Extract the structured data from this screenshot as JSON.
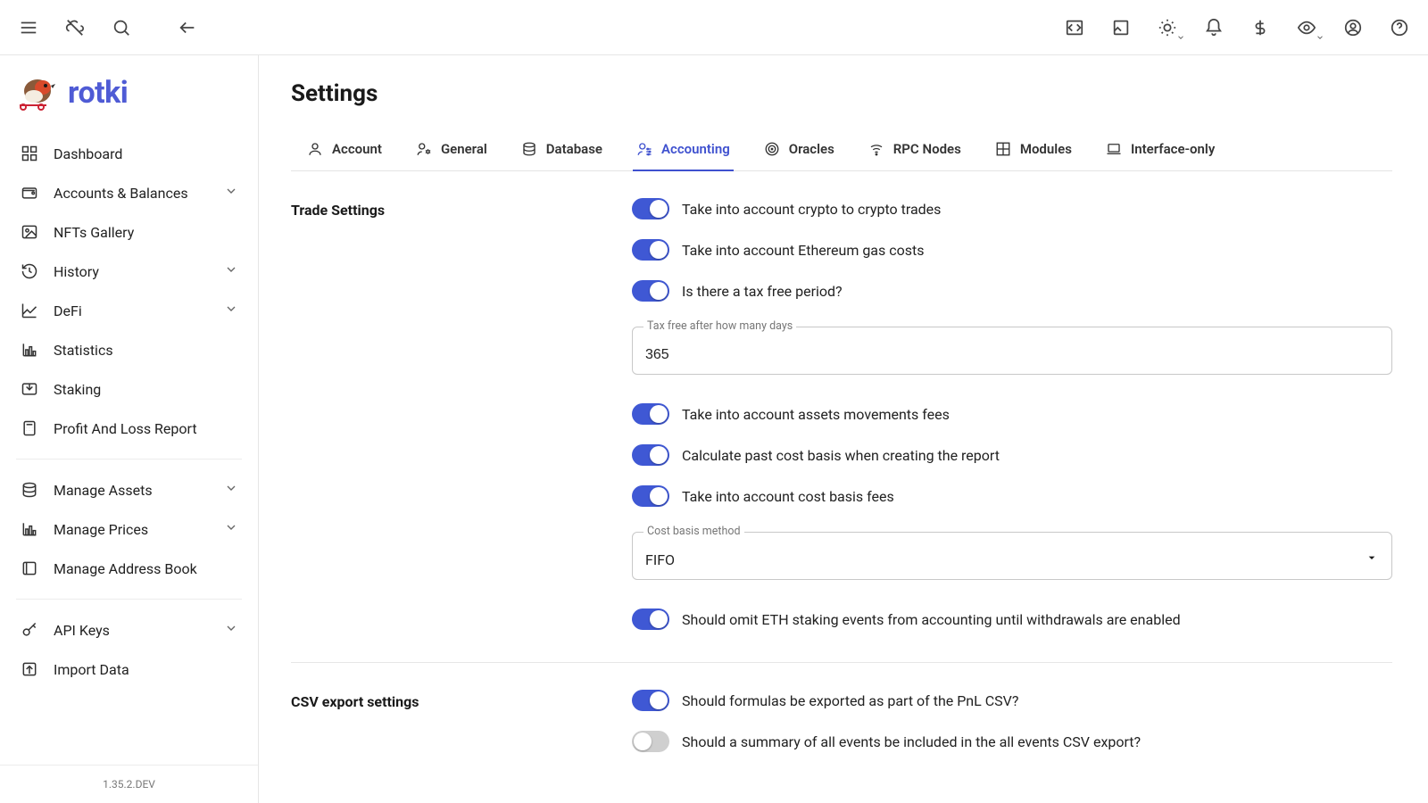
{
  "brand": "rotki",
  "version": "1.35.2.DEV",
  "page_title": "Settings",
  "sidebar": {
    "items": [
      {
        "label": "Dashboard",
        "icon": "dashboard",
        "expandable": false
      },
      {
        "label": "Accounts & Balances",
        "icon": "wallet",
        "expandable": true
      },
      {
        "label": "NFTs Gallery",
        "icon": "image",
        "expandable": false
      },
      {
        "label": "History",
        "icon": "history",
        "expandable": true
      },
      {
        "label": "DeFi",
        "icon": "chart-line",
        "expandable": true
      },
      {
        "label": "Statistics",
        "icon": "bar-chart",
        "expandable": false
      },
      {
        "label": "Staking",
        "icon": "inbox",
        "expandable": false
      },
      {
        "label": "Profit And Loss Report",
        "icon": "calculator",
        "expandable": false
      }
    ],
    "items2": [
      {
        "label": "Manage Assets",
        "icon": "database",
        "expandable": true
      },
      {
        "label": "Manage Prices",
        "icon": "bar-chart",
        "expandable": true
      },
      {
        "label": "Manage Address Book",
        "icon": "book",
        "expandable": false
      }
    ],
    "items3": [
      {
        "label": "API Keys",
        "icon": "key",
        "expandable": true
      },
      {
        "label": "Import Data",
        "icon": "upload",
        "expandable": false
      }
    ]
  },
  "tabs": [
    {
      "label": "Account",
      "icon": "user"
    },
    {
      "label": "General",
      "icon": "user-gear"
    },
    {
      "label": "Database",
      "icon": "database"
    },
    {
      "label": "Accounting",
      "icon": "user-sliders",
      "active": true
    },
    {
      "label": "Oracles",
      "icon": "target"
    },
    {
      "label": "RPC Nodes",
      "icon": "wifi"
    },
    {
      "label": "Modules",
      "icon": "grid"
    },
    {
      "label": "Interface-only",
      "icon": "laptop"
    }
  ],
  "sections": {
    "trade": {
      "title": "Trade Settings",
      "toggles": {
        "crypto2crypto": {
          "on": true,
          "label": "Take into account crypto to crypto trades"
        },
        "gas_costs": {
          "on": true,
          "label": "Take into account Ethereum gas costs"
        },
        "tax_free": {
          "on": true,
          "label": "Is there a tax free period?"
        },
        "asset_move": {
          "on": true,
          "label": "Take into account assets movements fees"
        },
        "past_cost": {
          "on": true,
          "label": "Calculate past cost basis when creating the report"
        },
        "cost_fees": {
          "on": true,
          "label": "Take into account cost basis fees"
        },
        "omit_eth": {
          "on": true,
          "label": "Should omit ETH staking events from accounting until withdrawals are enabled"
        }
      },
      "tax_free_days": {
        "label": "Tax free after how many days",
        "value": "365"
      },
      "cost_basis": {
        "label": "Cost basis method",
        "value": "FIFO"
      }
    },
    "csv": {
      "title": "CSV export settings",
      "toggles": {
        "formulas": {
          "on": true,
          "label": "Should formulas be exported as part of the PnL CSV?"
        },
        "summary": {
          "on": false,
          "label": "Should a summary of all events be included in the all events CSV export?"
        }
      }
    }
  }
}
